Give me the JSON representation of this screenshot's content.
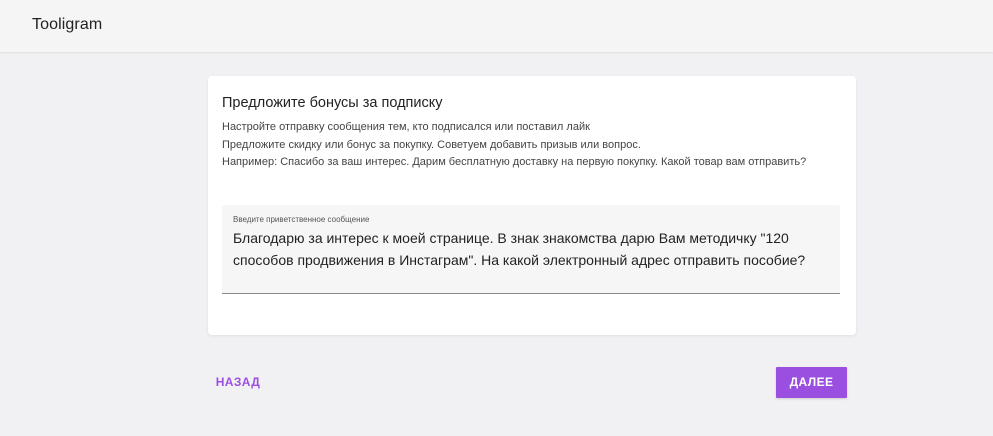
{
  "header": {
    "app_title": "Tooligram"
  },
  "card": {
    "title": "Предложите бонусы за подписку",
    "description_lines": [
      "Настройте отправку сообщения тем, кто подписался или поставил лайк",
      "Предложите скидку или бонус за покупку. Советуем добавить призыв или вопрос.",
      "Например: Спасибо за ваш интерес. Дарим бесплатную доставку на первую покупку. Какой товар вам отправить?"
    ],
    "field": {
      "label": "Введите приветственное сообщение",
      "value": "Благодарю за интерес к моей странице. В знак знакомства дарю Вам методичку \"120 способов продвижения в Инстаграм\". На какой электронный адрес отправить пособие?"
    }
  },
  "actions": {
    "back_label": "НАЗАД",
    "next_label": "ДАЛЕЕ"
  },
  "colors": {
    "accent": "#9b4fe0",
    "background": "#f1f1f4",
    "card": "#ffffff"
  }
}
